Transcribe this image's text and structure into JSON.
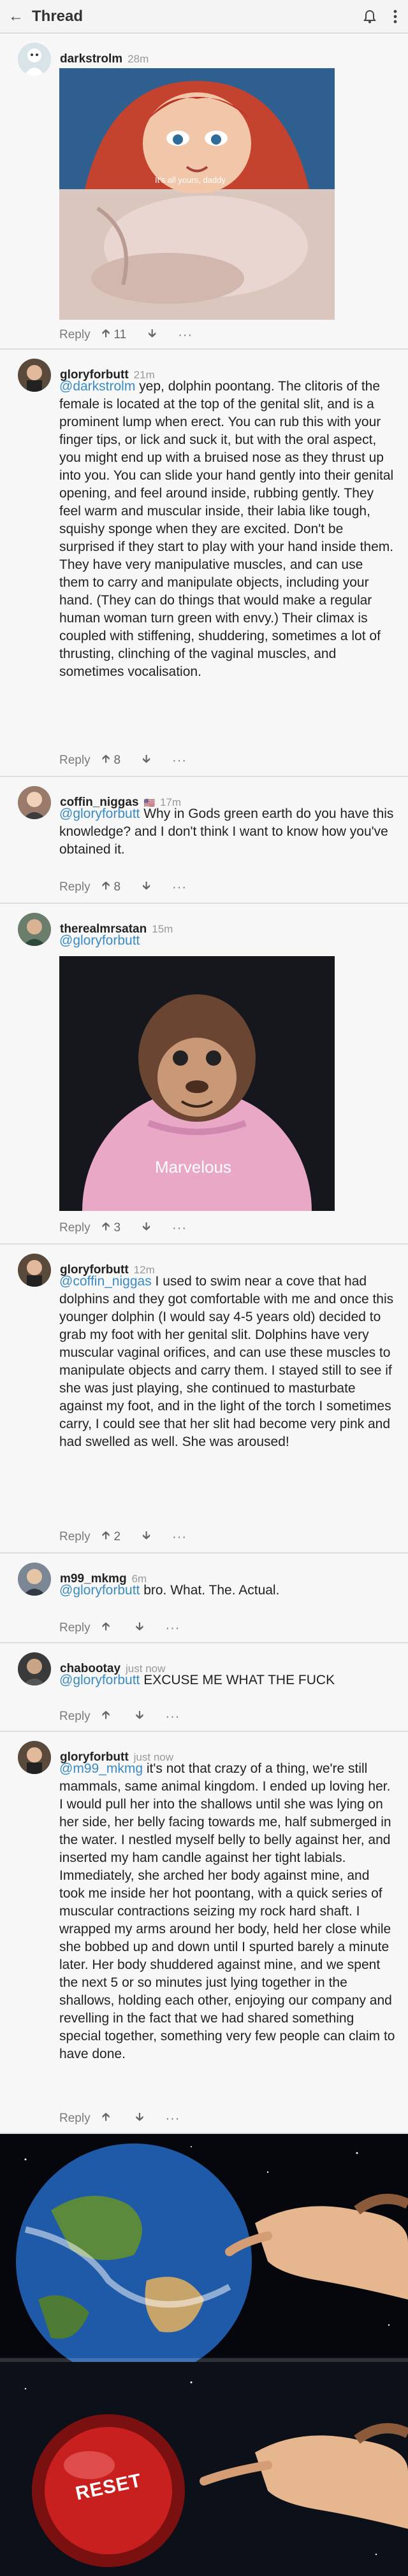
{
  "topbar": {
    "title": "Thread"
  },
  "comments": [
    {
      "user": "darkstrolm",
      "time": "28m",
      "caption": "It's all yours, daddy",
      "reply": "Reply",
      "score": "11"
    },
    {
      "user": "gloryforbutt",
      "time": "21m",
      "mention": "@darkstrolm",
      "text": " yep, dolphin poontang. The clitoris of the female is located at the top of the genital slit, and is a prominent lump when erect. You can rub this with your finger tips, or lick and suck it, but with the oral aspect, you might end up with a bruised nose as they thrust up into you. You can slide your hand gently into their genital opening, and feel around inside, rubbing gently. They feel warm and muscular inside, their labia like tough, squishy sponge when they are excited. Don't be surprised if they start to play with your hand inside them. They have very manipulative muscles, and can use them to carry and manipulate objects, including your hand. (They can do things that would make a regular human woman turn green with envy.) Their climax is coupled with stiffening, shuddering, sometimes a lot of thrusting, clinching of the vaginal muscles, and sometimes vocalisation.",
      "reply": "Reply",
      "score": "8"
    },
    {
      "user": "coffin_niggas",
      "flag": "🇺🇸",
      "time": "17m",
      "mention": "@gloryforbutt",
      "text": " Why in Gods green earth do you have this knowledge? and I don't think I want to know how you've obtained it.",
      "reply": "Reply",
      "score": "8"
    },
    {
      "user": "therealmrsatan",
      "time": "15m",
      "mention": "@gloryforbutt",
      "text": "",
      "caption": "Marvelous",
      "reply": "Reply",
      "score": "3"
    },
    {
      "user": "gloryforbutt",
      "time": "12m",
      "mention": "@coffin_niggas",
      "text": " I used to swim near a cove that had dolphins and they got comfortable with me and once this younger dolphin (I would say 4-5 years old) decided to grab my foot with her genital slit. Dolphins have very muscular vaginal orifices, and can use these muscles to manipulate objects and carry them. I stayed still to see if she was just playing, she continued to masturbate against my foot, and in the light of the torch I sometimes carry, I could see that her slit had become very pink and had swelled as well. She was aroused!",
      "reply": "Reply",
      "score": "2"
    },
    {
      "user": "m99_mkmg",
      "time": "6m",
      "mention": "@gloryforbutt",
      "text": " bro. What. The. Actual.",
      "reply": "Reply",
      "score": ""
    },
    {
      "user": "chabootay",
      "time": "just now",
      "mention": "@gloryforbutt",
      "text": " EXCUSE ME WHAT THE FUCK",
      "reply": "Reply",
      "score": ""
    },
    {
      "user": "gloryforbutt",
      "time": "just now",
      "mention": "@m99_mkmg",
      "text": " it's not that crazy of a thing, we're still mammals, same animal kingdom. I ended up loving her. I would pull her into the shallows until she was lying on her side, her belly facing towards me, half submerged in the water. I nestled myself belly to belly against her, and inserted my ham candle against her tight labials. Immediately, she arched her body against mine, and took me inside her hot poontang, with a quick series of muscular contractions seizing my rock hard shaft. I wrapped my arms around her body, held her close while she bobbed up and down until I spurted barely a minute later. Her body shuddered against mine, and we spent the next 5 or so minutes just lying together in the shallows, holding each other, enjoying our company and revelling in the fact that we had shared something special together, something very few people can claim to have done.",
      "reply": "Reply",
      "score": ""
    }
  ],
  "meme_bottom": {
    "button_text": "RESET"
  }
}
